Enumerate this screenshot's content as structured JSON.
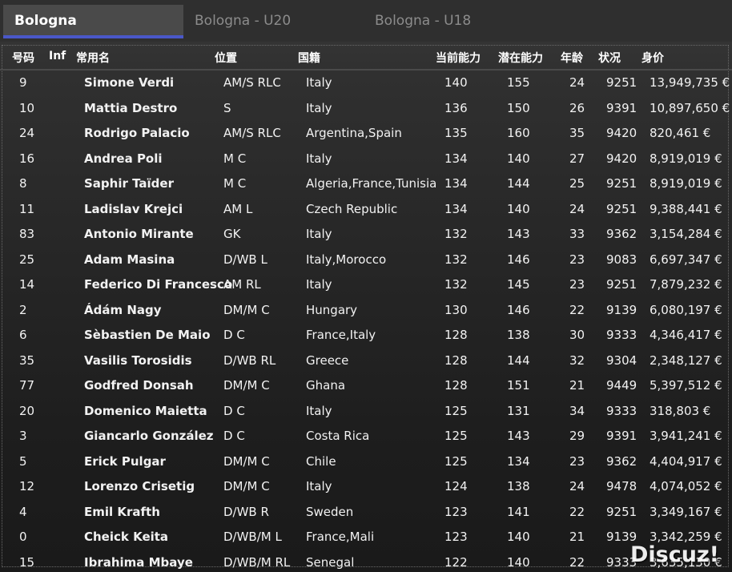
{
  "tabs": [
    {
      "label": "Bologna"
    },
    {
      "label": "Bologna - U20"
    },
    {
      "label": "Bologna - U18"
    }
  ],
  "columns": {
    "number": "号码",
    "inf": "Inf",
    "name": "常用名",
    "position": "位置",
    "nationality": "国籍",
    "current_ability": "当前能力",
    "potential_ability": "潜在能力",
    "age": "年龄",
    "condition": "状况",
    "value": "身价"
  },
  "players": [
    {
      "no": "9",
      "name": "Simone Verdi",
      "pos": "AM/S RLC",
      "nat": "Italy",
      "ca": "140",
      "pa": "155",
      "age": "24",
      "cond": "9251",
      "value": "13,949,735 €"
    },
    {
      "no": "10",
      "name": "Mattia Destro",
      "pos": "S",
      "nat": "Italy",
      "ca": "136",
      "pa": "150",
      "age": "26",
      "cond": "9391",
      "value": "10,897,650 €"
    },
    {
      "no": "24",
      "name": "Rodrigo Palacio",
      "pos": "AM/S RLC",
      "nat": "Argentina,Spain",
      "ca": "135",
      "pa": "160",
      "age": "35",
      "cond": "9420",
      "value": "820,461 €"
    },
    {
      "no": "16",
      "name": "Andrea Poli",
      "pos": "M C",
      "nat": "Italy",
      "ca": "134",
      "pa": "140",
      "age": "27",
      "cond": "9420",
      "value": "8,919,019 €"
    },
    {
      "no": "8",
      "name": "Saphir Taïder",
      "pos": "M C",
      "nat": "Algeria,France,Tunisia",
      "ca": "134",
      "pa": "144",
      "age": "25",
      "cond": "9251",
      "value": "8,919,019 €"
    },
    {
      "no": "11",
      "name": "Ladislav Krejci",
      "pos": "AM L",
      "nat": "Czech Republic",
      "ca": "134",
      "pa": "140",
      "age": "24",
      "cond": "9251",
      "value": "9,388,441 €"
    },
    {
      "no": "83",
      "name": "Antonio Mirante",
      "pos": "GK",
      "nat": "Italy",
      "ca": "132",
      "pa": "143",
      "age": "33",
      "cond": "9362",
      "value": "3,154,284 €"
    },
    {
      "no": "25",
      "name": "Adam Masina",
      "pos": "D/WB L",
      "nat": "Italy,Morocco",
      "ca": "132",
      "pa": "146",
      "age": "23",
      "cond": "9083",
      "value": "6,697,347 €"
    },
    {
      "no": "14",
      "name": "Federico Di Francesco",
      "pos": "AM RL",
      "nat": "Italy",
      "ca": "132",
      "pa": "145",
      "age": "23",
      "cond": "9251",
      "value": "7,879,232 €"
    },
    {
      "no": "2",
      "name": "Ádám Nagy",
      "pos": "DM/M C",
      "nat": "Hungary",
      "ca": "130",
      "pa": "146",
      "age": "22",
      "cond": "9139",
      "value": "6,080,197 €"
    },
    {
      "no": "6",
      "name": "Sèbastien De Maio",
      "pos": "D C",
      "nat": "France,Italy",
      "ca": "128",
      "pa": "138",
      "age": "30",
      "cond": "9333",
      "value": "4,346,417 €"
    },
    {
      "no": "35",
      "name": "Vasilis Torosidis",
      "pos": "D/WB RL",
      "nat": "Greece",
      "ca": "128",
      "pa": "144",
      "age": "32",
      "cond": "9304",
      "value": "2,348,127 €"
    },
    {
      "no": "77",
      "name": "Godfred Donsah",
      "pos": "DM/M C",
      "nat": "Ghana",
      "ca": "128",
      "pa": "151",
      "age": "21",
      "cond": "9449",
      "value": "5,397,512 €"
    },
    {
      "no": "20",
      "name": "Domenico Maietta",
      "pos": "D C",
      "nat": "Italy",
      "ca": "125",
      "pa": "131",
      "age": "34",
      "cond": "9333",
      "value": "318,803 €"
    },
    {
      "no": "3",
      "name": "Giancarlo González",
      "pos": "D C",
      "nat": "Costa Rica",
      "ca": "125",
      "pa": "143",
      "age": "29",
      "cond": "9391",
      "value": "3,941,241 €"
    },
    {
      "no": "5",
      "name": "Erick Pulgar",
      "pos": "DM/M C",
      "nat": "Chile",
      "ca": "125",
      "pa": "134",
      "age": "23",
      "cond": "9362",
      "value": "4,404,917 €"
    },
    {
      "no": "12",
      "name": "Lorenzo Crisetig",
      "pos": "DM/M C",
      "nat": "Italy",
      "ca": "124",
      "pa": "138",
      "age": "24",
      "cond": "9478",
      "value": "4,074,052 €"
    },
    {
      "no": "4",
      "name": "Emil Krafth",
      "pos": "D/WB R",
      "nat": "Sweden",
      "ca": "123",
      "pa": "141",
      "age": "22",
      "cond": "9251",
      "value": "3,349,167 €"
    },
    {
      "no": "0",
      "name": "Cheick Keita",
      "pos": "D/WB/M L",
      "nat": "France,Mali",
      "ca": "123",
      "pa": "140",
      "age": "21",
      "cond": "9139",
      "value": "3,342,259 €"
    },
    {
      "no": "15",
      "name": "Ibrahima Mbaye",
      "pos": "D/WB/M RL",
      "nat": "Senegal",
      "ca": "122",
      "pa": "140",
      "age": "22",
      "cond": "9333",
      "value": "3,635,130 €"
    }
  ],
  "watermark": "Discuz!"
}
